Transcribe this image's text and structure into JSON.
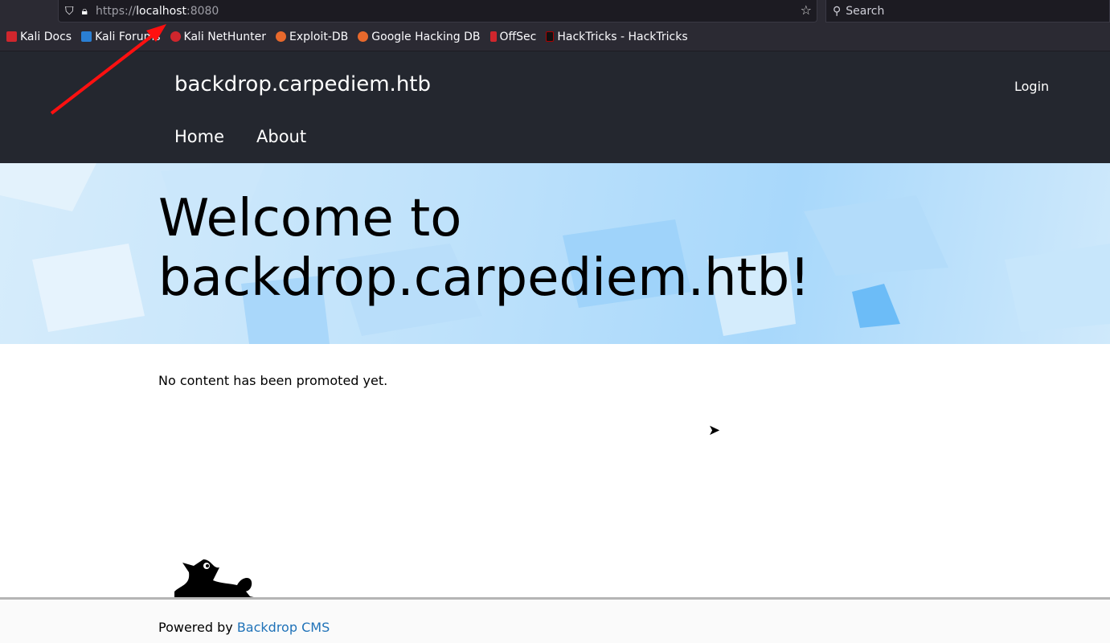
{
  "browser": {
    "url_scheme": "https://",
    "url_host": "localhost",
    "url_port": ":8080",
    "search_placeholder": "Search",
    "bookmarks": [
      {
        "label": "Kali Docs",
        "color": "#d0262d"
      },
      {
        "label": "Kali Forums",
        "color": "#2a7fd4"
      },
      {
        "label": "Kali NetHunter",
        "color": "#d0262d"
      },
      {
        "label": "Exploit-DB",
        "color": "#e8692c"
      },
      {
        "label": "Google Hacking DB",
        "color": "#e8692c"
      },
      {
        "label": "OffSec",
        "color": "#d0262d"
      },
      {
        "label": "HackTricks - HackTricks",
        "color": "#222"
      }
    ]
  },
  "site": {
    "name": "backdrop.carpediem.htb",
    "login": "Login",
    "nav": [
      "Home",
      "About"
    ],
    "hero_title": "Welcome to backdrop.carpediem.htb!",
    "content": "No content has been promoted yet.",
    "footer_prefix": "Powered by ",
    "footer_link": "Backdrop CMS"
  },
  "annotation": {
    "arrow_color": "#ff0000"
  }
}
